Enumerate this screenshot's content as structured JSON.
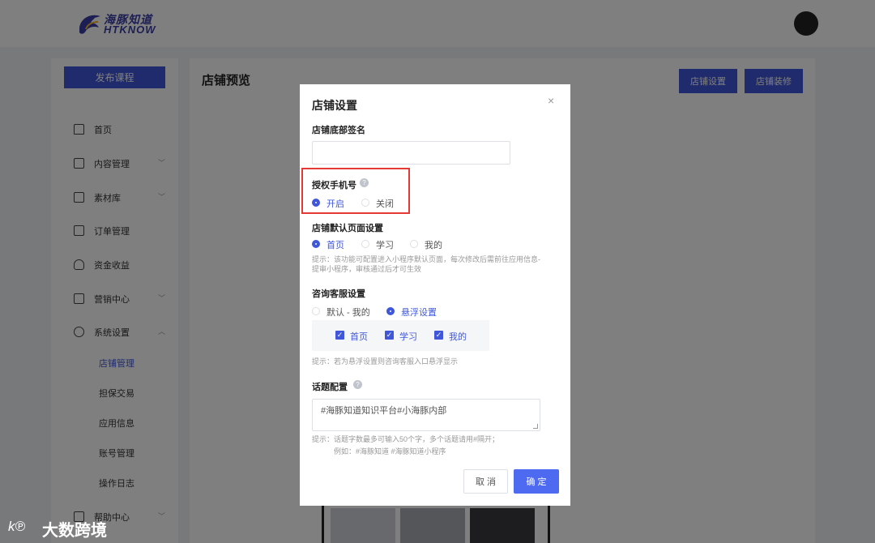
{
  "brand": {
    "name_cn": "海豚知道",
    "name_en": "HTKNOW"
  },
  "sidebar": {
    "publish_label": "发布课程",
    "items": [
      {
        "label": "首页",
        "has_arrow": false
      },
      {
        "label": "内容管理",
        "has_arrow": true
      },
      {
        "label": "素材库",
        "has_arrow": true
      },
      {
        "label": "订单管理",
        "has_arrow": false
      },
      {
        "label": "资金收益",
        "has_arrow": false
      },
      {
        "label": "营销中心",
        "has_arrow": true
      },
      {
        "label": "系统设置",
        "has_arrow": true,
        "expanded": true
      },
      {
        "label": "帮助中心",
        "has_arrow": true
      }
    ],
    "sub_items": [
      {
        "label": "店铺管理",
        "active": true
      },
      {
        "label": "担保交易",
        "active": false
      },
      {
        "label": "应用信息",
        "active": false
      },
      {
        "label": "账号管理",
        "active": false
      },
      {
        "label": "操作日志",
        "active": false
      }
    ]
  },
  "main": {
    "title": "店铺预览",
    "settings_button": "店铺设置",
    "decorate_button": "店铺装修"
  },
  "modal": {
    "title": "店铺设置",
    "close_icon": "×",
    "footer_signature": {
      "label": "店铺底部签名",
      "value": ""
    },
    "auth_phone": {
      "label": "授权手机号",
      "options": [
        {
          "label": "开启",
          "selected": true
        },
        {
          "label": "关闭",
          "selected": false
        }
      ]
    },
    "default_page": {
      "label": "店铺默认页面设置",
      "options": [
        {
          "label": "首页",
          "selected": true
        },
        {
          "label": "学习",
          "selected": false
        },
        {
          "label": "我的",
          "selected": false
        }
      ],
      "hint_line1": "提示：该功能可配置进入小程序默认页面，每次修改后需前往应用信息-",
      "hint_line2": "提审小程序，审核通过后才可生效"
    },
    "consult": {
      "label": "咨询客服设置",
      "options": [
        {
          "label": "默认 - 我的",
          "selected": false
        },
        {
          "label": "悬浮设置",
          "selected": true
        }
      ],
      "checks": [
        {
          "label": "首页",
          "checked": true
        },
        {
          "label": "学习",
          "checked": true
        },
        {
          "label": "我的",
          "checked": true
        }
      ],
      "hint": "提示：若为悬浮设置则咨询客服入口悬浮显示"
    },
    "topic": {
      "label": "话题配置",
      "value": "#海豚知道知识平台#小海豚内部",
      "hint_line1": "提示：话题字数最多可输入50个字，多个话题请用#隔开；",
      "hint_line2": "例如：#海豚知道 #海豚知道小程序"
    },
    "cancel_label": "取 消",
    "ok_label": "确 定"
  },
  "watermark": {
    "logo": "k℗",
    "text": "大数跨境"
  },
  "colors": {
    "accent": "#3f57d8",
    "highlight": "#e53935"
  }
}
